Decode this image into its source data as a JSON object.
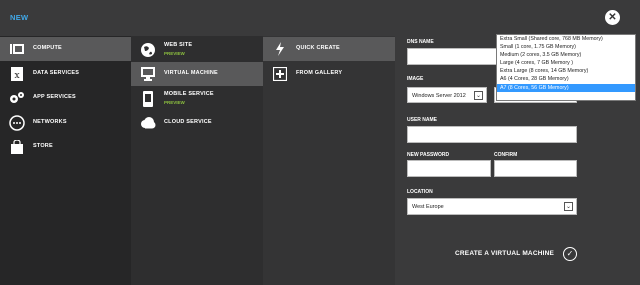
{
  "header": {
    "title": "NEW",
    "close_glyph": "✕"
  },
  "nav": {
    "col1": [
      {
        "label": "COMPUTE",
        "icon": "compute-icon",
        "selected": true
      },
      {
        "label": "DATA SERVICES",
        "icon": "database-icon",
        "selected": false
      },
      {
        "label": "APP SERVICES",
        "icon": "gears-icon",
        "selected": false
      },
      {
        "label": "NETWORKS",
        "icon": "network-icon",
        "selected": false
      },
      {
        "label": "STORE",
        "icon": "shopping-bag-icon",
        "selected": false
      }
    ],
    "col2": [
      {
        "label": "WEB SITE",
        "sub": "PREVIEW",
        "icon": "globe-icon",
        "selected": false
      },
      {
        "label": "VIRTUAL MACHINE",
        "sub": "",
        "icon": "monitor-icon",
        "selected": true
      },
      {
        "label": "MOBILE SERVICE",
        "sub": "PREVIEW",
        "icon": "mobile-icon",
        "selected": false
      },
      {
        "label": "CLOUD SERVICE",
        "sub": "",
        "icon": "cloud-icon",
        "selected": false
      }
    ],
    "col3": [
      {
        "label": "QUICK CREATE",
        "icon": "lightning-icon",
        "selected": true
      },
      {
        "label": "FROM GALLERY",
        "icon": "plus-square-icon",
        "selected": false
      }
    ]
  },
  "form": {
    "dns_label": "DNS NAME",
    "image_label": "IMAGE",
    "image_value": "Windows Server 2012",
    "username_label": "USER NAME",
    "password_label": "NEW PASSWORD",
    "confirm_label": "CONFIRM",
    "location_label": "LOCATION",
    "location_value": "West Europe"
  },
  "size_dropdown": {
    "options": [
      "Extra Small (Shared core, 768 MB Memory)",
      "Small (1 core, 1.75 GB Memory)",
      "Medium (2 cores, 3.5 GB Memory)",
      "Large (4 cores, 7 GB Memory )",
      "Extra Large (8 cores, 14 GB Memory)",
      "A6 (4 Cores, 28 GB Memory)",
      "A7 (8 Cores, 56 GB Memory)"
    ],
    "highlighted_index": 6,
    "highlight_color": "#3399ff"
  },
  "footer": {
    "create_label": "CREATE A VIRTUAL MACHINE",
    "check_glyph": "✓"
  },
  "colors": {
    "accent": "#41a8e8",
    "preview": "#8cbf3f",
    "background": "#3a3a3b"
  }
}
